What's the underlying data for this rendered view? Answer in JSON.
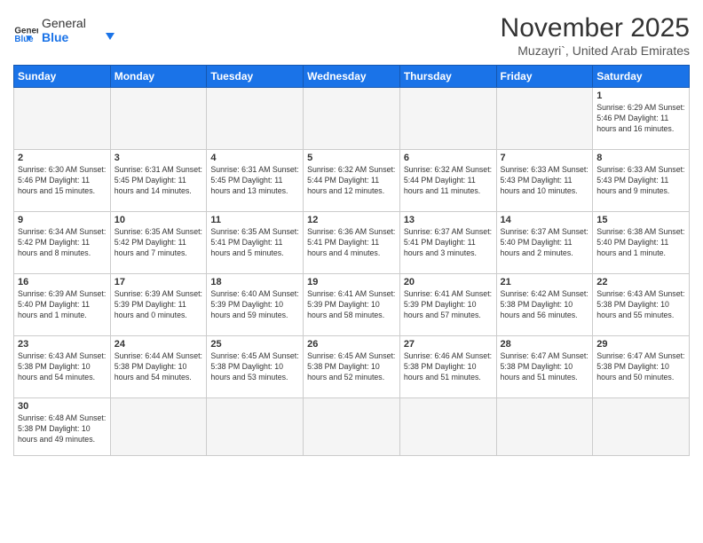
{
  "logo": {
    "text_general": "General",
    "text_blue": "Blue"
  },
  "title": "November 2025",
  "location": "Muzayri`, United Arab Emirates",
  "days_of_week": [
    "Sunday",
    "Monday",
    "Tuesday",
    "Wednesday",
    "Thursday",
    "Friday",
    "Saturday"
  ],
  "weeks": [
    [
      {
        "day": "",
        "info": ""
      },
      {
        "day": "",
        "info": ""
      },
      {
        "day": "",
        "info": ""
      },
      {
        "day": "",
        "info": ""
      },
      {
        "day": "",
        "info": ""
      },
      {
        "day": "",
        "info": ""
      },
      {
        "day": "1",
        "info": "Sunrise: 6:29 AM\nSunset: 5:46 PM\nDaylight: 11 hours and 16 minutes."
      }
    ],
    [
      {
        "day": "2",
        "info": "Sunrise: 6:30 AM\nSunset: 5:46 PM\nDaylight: 11 hours and 15 minutes."
      },
      {
        "day": "3",
        "info": "Sunrise: 6:31 AM\nSunset: 5:45 PM\nDaylight: 11 hours and 14 minutes."
      },
      {
        "day": "4",
        "info": "Sunrise: 6:31 AM\nSunset: 5:45 PM\nDaylight: 11 hours and 13 minutes."
      },
      {
        "day": "5",
        "info": "Sunrise: 6:32 AM\nSunset: 5:44 PM\nDaylight: 11 hours and 12 minutes."
      },
      {
        "day": "6",
        "info": "Sunrise: 6:32 AM\nSunset: 5:44 PM\nDaylight: 11 hours and 11 minutes."
      },
      {
        "day": "7",
        "info": "Sunrise: 6:33 AM\nSunset: 5:43 PM\nDaylight: 11 hours and 10 minutes."
      },
      {
        "day": "8",
        "info": "Sunrise: 6:33 AM\nSunset: 5:43 PM\nDaylight: 11 hours and 9 minutes."
      }
    ],
    [
      {
        "day": "9",
        "info": "Sunrise: 6:34 AM\nSunset: 5:42 PM\nDaylight: 11 hours and 8 minutes."
      },
      {
        "day": "10",
        "info": "Sunrise: 6:35 AM\nSunset: 5:42 PM\nDaylight: 11 hours and 7 minutes."
      },
      {
        "day": "11",
        "info": "Sunrise: 6:35 AM\nSunset: 5:41 PM\nDaylight: 11 hours and 5 minutes."
      },
      {
        "day": "12",
        "info": "Sunrise: 6:36 AM\nSunset: 5:41 PM\nDaylight: 11 hours and 4 minutes."
      },
      {
        "day": "13",
        "info": "Sunrise: 6:37 AM\nSunset: 5:41 PM\nDaylight: 11 hours and 3 minutes."
      },
      {
        "day": "14",
        "info": "Sunrise: 6:37 AM\nSunset: 5:40 PM\nDaylight: 11 hours and 2 minutes."
      },
      {
        "day": "15",
        "info": "Sunrise: 6:38 AM\nSunset: 5:40 PM\nDaylight: 11 hours and 1 minute."
      }
    ],
    [
      {
        "day": "16",
        "info": "Sunrise: 6:39 AM\nSunset: 5:40 PM\nDaylight: 11 hours and 1 minute."
      },
      {
        "day": "17",
        "info": "Sunrise: 6:39 AM\nSunset: 5:39 PM\nDaylight: 11 hours and 0 minutes."
      },
      {
        "day": "18",
        "info": "Sunrise: 6:40 AM\nSunset: 5:39 PM\nDaylight: 10 hours and 59 minutes."
      },
      {
        "day": "19",
        "info": "Sunrise: 6:41 AM\nSunset: 5:39 PM\nDaylight: 10 hours and 58 minutes."
      },
      {
        "day": "20",
        "info": "Sunrise: 6:41 AM\nSunset: 5:39 PM\nDaylight: 10 hours and 57 minutes."
      },
      {
        "day": "21",
        "info": "Sunrise: 6:42 AM\nSunset: 5:38 PM\nDaylight: 10 hours and 56 minutes."
      },
      {
        "day": "22",
        "info": "Sunrise: 6:43 AM\nSunset: 5:38 PM\nDaylight: 10 hours and 55 minutes."
      }
    ],
    [
      {
        "day": "23",
        "info": "Sunrise: 6:43 AM\nSunset: 5:38 PM\nDaylight: 10 hours and 54 minutes."
      },
      {
        "day": "24",
        "info": "Sunrise: 6:44 AM\nSunset: 5:38 PM\nDaylight: 10 hours and 54 minutes."
      },
      {
        "day": "25",
        "info": "Sunrise: 6:45 AM\nSunset: 5:38 PM\nDaylight: 10 hours and 53 minutes."
      },
      {
        "day": "26",
        "info": "Sunrise: 6:45 AM\nSunset: 5:38 PM\nDaylight: 10 hours and 52 minutes."
      },
      {
        "day": "27",
        "info": "Sunrise: 6:46 AM\nSunset: 5:38 PM\nDaylight: 10 hours and 51 minutes."
      },
      {
        "day": "28",
        "info": "Sunrise: 6:47 AM\nSunset: 5:38 PM\nDaylight: 10 hours and 51 minutes."
      },
      {
        "day": "29",
        "info": "Sunrise: 6:47 AM\nSunset: 5:38 PM\nDaylight: 10 hours and 50 minutes."
      }
    ],
    [
      {
        "day": "30",
        "info": "Sunrise: 6:48 AM\nSunset: 5:38 PM\nDaylight: 10 hours and 49 minutes."
      },
      {
        "day": "",
        "info": ""
      },
      {
        "day": "",
        "info": ""
      },
      {
        "day": "",
        "info": ""
      },
      {
        "day": "",
        "info": ""
      },
      {
        "day": "",
        "info": ""
      },
      {
        "day": "",
        "info": ""
      }
    ]
  ]
}
